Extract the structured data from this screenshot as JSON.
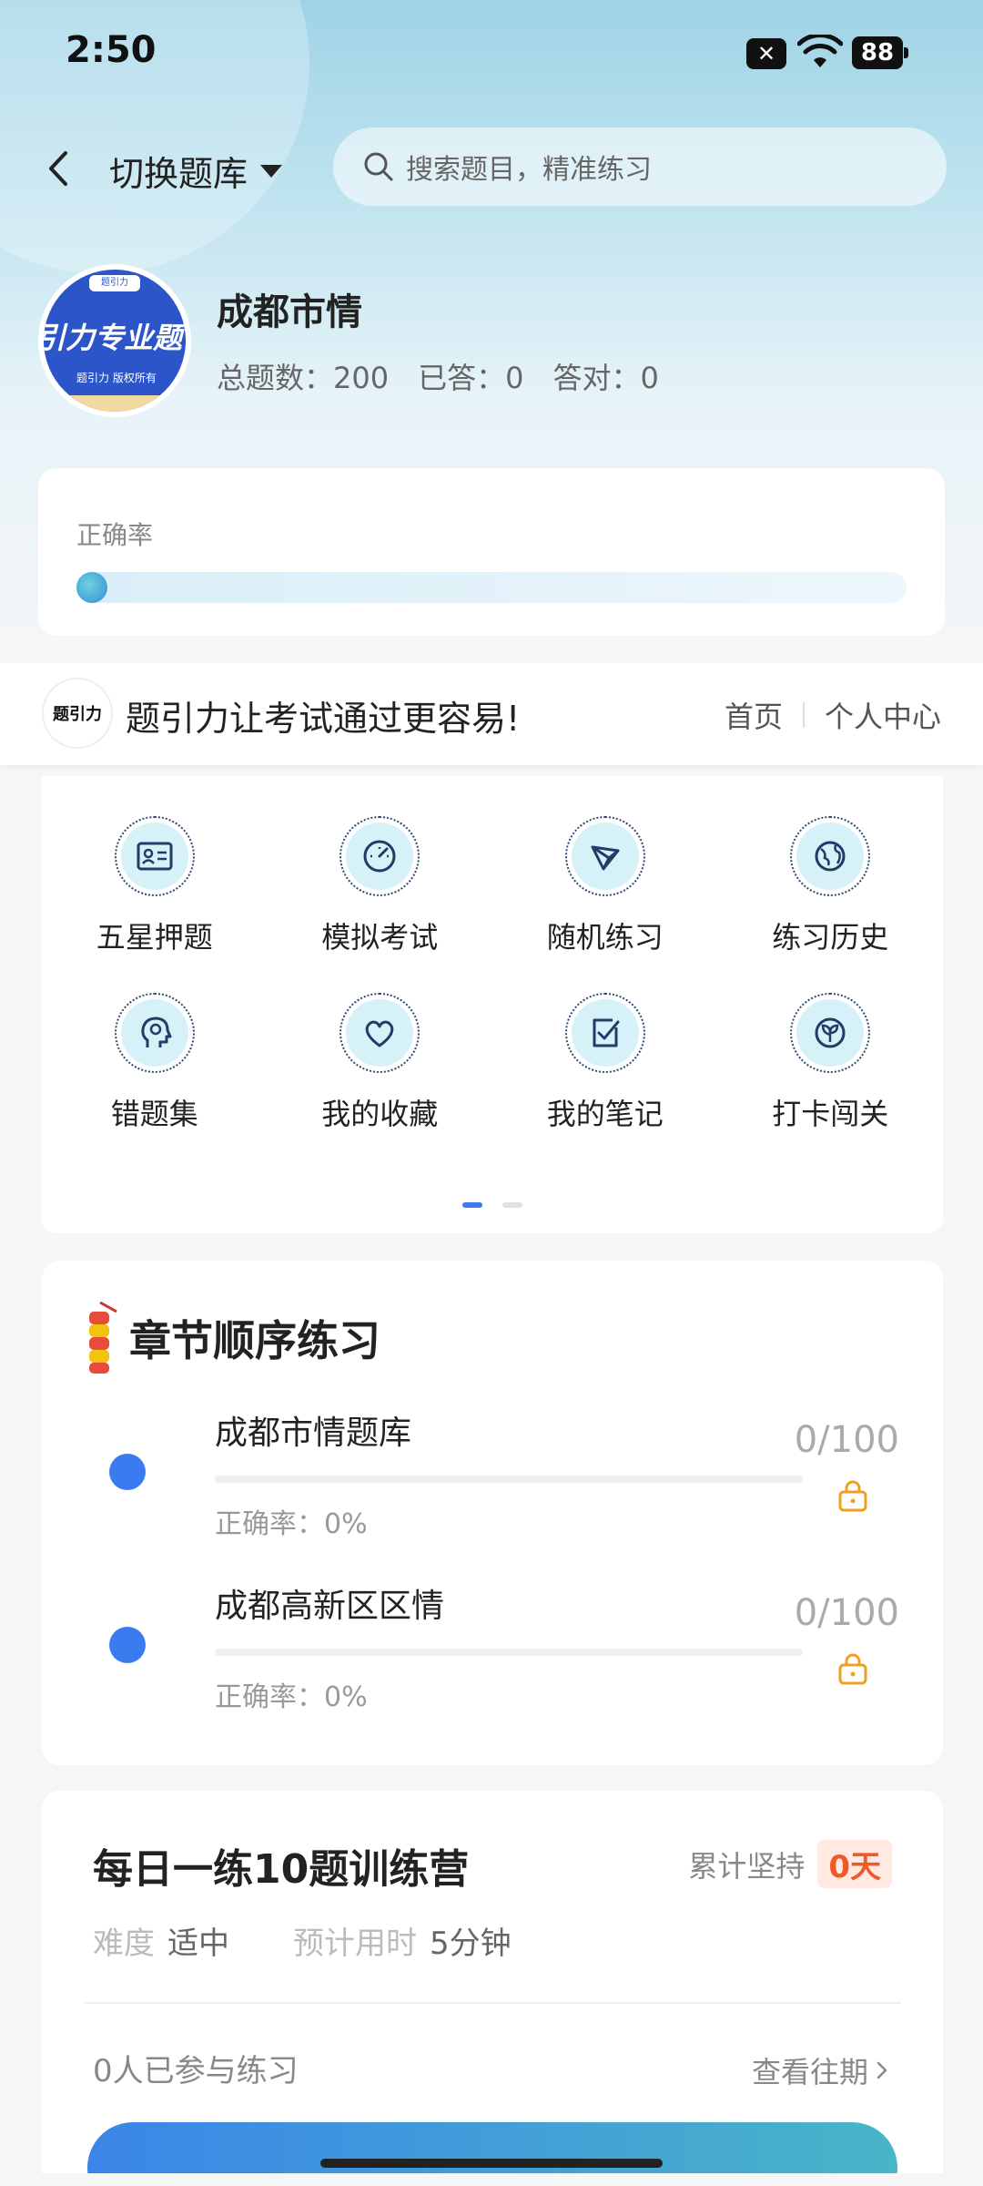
{
  "status_bar": {
    "time": "2:50",
    "battery": "88"
  },
  "nav": {
    "switch_label": "切换题库",
    "search_placeholder": "搜索题目，精准练习"
  },
  "profile": {
    "logo_text": "引力专业题",
    "logo_pill": "题引力",
    "logo_sub": "题引力 版权所有",
    "title": "成都市情",
    "stats": {
      "total": "总题数：200",
      "answered": "已答：0",
      "correct": "答对：0"
    }
  },
  "accuracy": {
    "label": "正确率",
    "value": 0
  },
  "banner": {
    "logo_text": "题引力",
    "text": "题引力让考试通过更容易!",
    "home_link": "首页",
    "profile_link": "个人中心"
  },
  "features": {
    "items": [
      {
        "label": "五星押题",
        "icon": "id-card-icon"
      },
      {
        "label": "模拟考试",
        "icon": "gauge-icon"
      },
      {
        "label": "随机练习",
        "icon": "network-icon"
      },
      {
        "label": "练习历史",
        "icon": "globe-icon"
      },
      {
        "label": "错题集",
        "icon": "head-icon"
      },
      {
        "label": "我的收藏",
        "icon": "heart-icon"
      },
      {
        "label": "我的笔记",
        "icon": "note-check-icon"
      },
      {
        "label": "打卡闯关",
        "icon": "sprout-icon"
      }
    ],
    "page": 1,
    "pages": 2
  },
  "chapters": {
    "title": "章节顺序练习",
    "items": [
      {
        "name": "成都市情题库",
        "accuracy": "正确率：0%",
        "count": "0/100",
        "locked": true
      },
      {
        "name": "成都高新区区情",
        "accuracy": "正确率：0%",
        "count": "0/100",
        "locked": true
      }
    ]
  },
  "daily": {
    "title": "每日一练10题训练营",
    "streak_label": "累计坚持",
    "streak_value": "0天",
    "difficulty_label": "难度",
    "difficulty_value": "适中",
    "time_label": "预计用时",
    "time_value": "5分钟",
    "participants": "0人已参与练习",
    "history_link": "查看往期"
  },
  "colors": {
    "accent": "#3a7cf0",
    "streak": "#f05a2a",
    "icon_bg": "#d7f1f8"
  }
}
